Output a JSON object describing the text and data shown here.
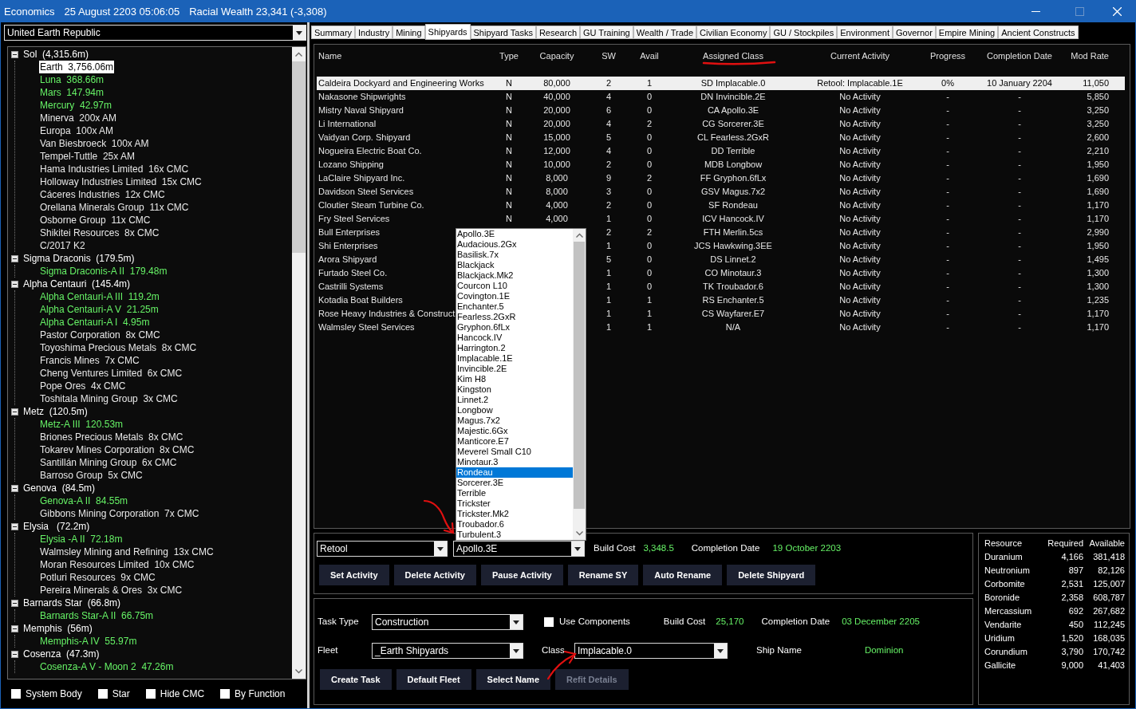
{
  "window": {
    "title": "Economics",
    "date": "25 August 2203 05:06:05",
    "wealth": "Racial Wealth 23,341 (-3,308)"
  },
  "race_select": {
    "value": "United Earth Republic"
  },
  "tree": [
    {
      "label": "Sol  (4,315.6m)",
      "expanded": true,
      "children": [
        {
          "label": "Earth  3,756.06m",
          "selected": true
        },
        {
          "label": "Luna  368.66m",
          "populated": true,
          "selected": false
        },
        {
          "label": "Mars  147.94m",
          "populated": true,
          "selected": false
        },
        {
          "label": "Mercury  42.97m",
          "populated": true,
          "selected": false
        },
        {
          "label": "Minerva  200x AM",
          "populated": false,
          "selected": false
        },
        {
          "label": "Europa  100x AM",
          "populated": false,
          "selected": false
        },
        {
          "label": "Van Biesbroeck  100x AM",
          "populated": false,
          "selected": false
        },
        {
          "label": "Tempel-Tuttle  25x AM",
          "populated": false,
          "selected": false
        },
        {
          "label": "Hama Industries Limited  16x CMC",
          "populated": false,
          "selected": false
        },
        {
          "label": "Holloway Industries Limited  15x CMC",
          "populated": false,
          "selected": false
        },
        {
          "label": "Cáceres Industries  12x CMC",
          "populated": false,
          "selected": false
        },
        {
          "label": "Orellana Minerals Group  11x CMC",
          "populated": false,
          "selected": false
        },
        {
          "label": "Osborne Group  11x CMC",
          "populated": false,
          "selected": false
        },
        {
          "label": "Shikitei Resources  8x CMC",
          "populated": false,
          "selected": false
        },
        {
          "label": "C/2017 K2",
          "populated": false,
          "selected": false
        }
      ]
    },
    {
      "label": "Sigma Draconis  (179.5m)",
      "expanded": true,
      "children": [
        {
          "label": "Sigma Draconis-A II  179.48m",
          "populated": true,
          "selected": false
        }
      ]
    },
    {
      "label": "Alpha Centauri  (145.4m)",
      "expanded": true,
      "children": [
        {
          "label": "Alpha Centauri-A III  119.2m",
          "populated": true,
          "selected": false
        },
        {
          "label": "Alpha Centauri-A V  21.25m",
          "populated": true,
          "selected": false
        },
        {
          "label": "Alpha Centauri-A I  4.95m",
          "populated": true,
          "selected": false
        },
        {
          "label": "Pastor Corporation  8x CMC",
          "populated": false,
          "selected": false
        },
        {
          "label": "Toyoshima Precious Metals  8x CMC",
          "populated": false,
          "selected": false
        },
        {
          "label": "Francis Mines  7x CMC",
          "populated": false,
          "selected": false
        },
        {
          "label": "Cheng Ventures Limited  6x CMC",
          "populated": false,
          "selected": false
        },
        {
          "label": "Pope Ores  4x CMC",
          "populated": false,
          "selected": false
        },
        {
          "label": "Toshitala Mining Group  3x CMC",
          "populated": false,
          "selected": false
        }
      ]
    },
    {
      "label": "Metz  (120.5m)",
      "expanded": true,
      "children": [
        {
          "label": "Metz-A III  120.53m",
          "populated": true,
          "selected": false
        },
        {
          "label": "Briones Precious Metals  8x CMC",
          "populated": false,
          "selected": false
        },
        {
          "label": "Tokarev Mines Corporation  8x CMC",
          "populated": false,
          "selected": false
        },
        {
          "label": "Santillán Mining Group  6x CMC",
          "populated": false,
          "selected": false
        },
        {
          "label": "Barroso Group  5x CMC",
          "populated": false,
          "selected": false
        }
      ]
    },
    {
      "label": "Genova  (84.5m)",
      "expanded": true,
      "children": [
        {
          "label": "Genova-A II  84.55m",
          "populated": true,
          "selected": false
        },
        {
          "label": "Gibbons Mining Corporation  7x CMC",
          "populated": false,
          "selected": false
        }
      ]
    },
    {
      "label": "Elysia   (72.2m)",
      "expanded": true,
      "children": [
        {
          "label": "Elysia -A II  72.18m",
          "populated": true,
          "selected": false
        },
        {
          "label": "Walmsley Mining and Refining  13x CMC",
          "populated": false,
          "selected": false
        },
        {
          "label": "Moran Resources Limited  10x CMC",
          "populated": false,
          "selected": false
        },
        {
          "label": "Potluri Resources  9x CMC",
          "populated": false,
          "selected": false
        },
        {
          "label": "Pereira Minerals & Ores  3x CMC",
          "populated": false,
          "selected": false
        }
      ]
    },
    {
      "label": "Barnards Star  (66.8m)",
      "expanded": true,
      "children": [
        {
          "label": "Barnards Star-A II  66.75m",
          "populated": true,
          "selected": false
        }
      ]
    },
    {
      "label": "Memphis  (56m)",
      "expanded": true,
      "children": [
        {
          "label": "Memphis-A IV  55.97m",
          "populated": true,
          "selected": false
        }
      ]
    },
    {
      "label": "Cosenza  (47.3m)",
      "expanded": true,
      "children": [
        {
          "label": "Cosenza-A V - Moon 2  47.26m",
          "populated": true,
          "selected": false
        }
      ]
    }
  ],
  "filters": [
    {
      "label": "System Body",
      "checked": false
    },
    {
      "label": "Star",
      "checked": false
    },
    {
      "label": "Hide CMC",
      "checked": false
    },
    {
      "label": "By Function",
      "checked": false
    }
  ],
  "tabs": [
    {
      "label": "Summary",
      "selected": false
    },
    {
      "label": "Industry",
      "selected": false
    },
    {
      "label": "Mining",
      "selected": false
    },
    {
      "label": "Shipyards",
      "selected": true
    },
    {
      "label": "Shipyard Tasks",
      "selected": false
    },
    {
      "label": "Research",
      "selected": false
    },
    {
      "label": "GU Training",
      "selected": false
    },
    {
      "label": "Wealth / Trade",
      "selected": false
    },
    {
      "label": "Civilian Economy",
      "selected": false
    },
    {
      "label": "GU / Stockpiles",
      "selected": false
    },
    {
      "label": "Environment",
      "selected": false
    },
    {
      "label": "Governor",
      "selected": false
    },
    {
      "label": "Empire Mining",
      "selected": false
    },
    {
      "label": "Ancient Constructs",
      "selected": false
    }
  ],
  "table": {
    "columns": [
      "Name",
      "Type",
      "Capacity",
      "SW",
      "Avail",
      "Assigned Class",
      "Current Activity",
      "Progress",
      "Completion Date",
      "Mod Rate"
    ],
    "rows": [
      {
        "name": "Caldeira Dockyard and Engineering Works",
        "type": "N",
        "capacity": "80,000",
        "sw": "2",
        "avail": "1",
        "assigned_class": "SD Implacable.0",
        "activity": "Retool: Implacable.1E",
        "progress": "0%",
        "completion": "10 January 2204",
        "mod_rate": "11,050",
        "selected": true
      },
      {
        "name": "Nakasone Shipwrights",
        "type": "N",
        "capacity": "40,000",
        "sw": "4",
        "avail": "0",
        "assigned_class": "DN Invincible.2E",
        "activity": "No Activity",
        "progress": "-",
        "completion": "-",
        "mod_rate": "5,850",
        "selected": false
      },
      {
        "name": "Mistry Naval Shipyard",
        "type": "N",
        "capacity": "20,000",
        "sw": "6",
        "avail": "0",
        "assigned_class": "CA Apollo.3E",
        "activity": "No Activity",
        "progress": "-",
        "completion": "-",
        "mod_rate": "3,250",
        "selected": false
      },
      {
        "name": "Li International",
        "type": "N",
        "capacity": "20,000",
        "sw": "4",
        "avail": "2",
        "assigned_class": "CG Sorcerer.3E",
        "activity": "No Activity",
        "progress": "-",
        "completion": "-",
        "mod_rate": "3,250",
        "selected": false
      },
      {
        "name": "Vaidyan Corp. Shipyard",
        "type": "N",
        "capacity": "15,000",
        "sw": "5",
        "avail": "0",
        "assigned_class": "CL Fearless.2GxR",
        "activity": "No Activity",
        "progress": "-",
        "completion": "-",
        "mod_rate": "2,600",
        "selected": false
      },
      {
        "name": "Nogueira Electric Boat Co.",
        "type": "N",
        "capacity": "12,000",
        "sw": "4",
        "avail": "0",
        "assigned_class": "DD Terrible",
        "activity": "No Activity",
        "progress": "-",
        "completion": "-",
        "mod_rate": "2,210",
        "selected": false
      },
      {
        "name": "Lozano Shipping",
        "type": "N",
        "capacity": "10,000",
        "sw": "2",
        "avail": "0",
        "assigned_class": "MDB Longbow",
        "activity": "No Activity",
        "progress": "-",
        "completion": "-",
        "mod_rate": "1,950",
        "selected": false
      },
      {
        "name": "LaClaire Shipyard Inc.",
        "type": "N",
        "capacity": "8,000",
        "sw": "9",
        "avail": "2",
        "assigned_class": "FF Gryphon.6fLx",
        "activity": "No Activity",
        "progress": "-",
        "completion": "-",
        "mod_rate": "1,690",
        "selected": false
      },
      {
        "name": "Davidson Steel Services",
        "type": "N",
        "capacity": "8,000",
        "sw": "3",
        "avail": "0",
        "assigned_class": "GSV Magus.7x2",
        "activity": "No Activity",
        "progress": "-",
        "completion": "-",
        "mod_rate": "1,690",
        "selected": false
      },
      {
        "name": "Cloutier Steam Turbine Co.",
        "type": "N",
        "capacity": "4,000",
        "sw": "2",
        "avail": "0",
        "assigned_class": "SF Rondeau",
        "activity": "No Activity",
        "progress": "-",
        "completion": "-",
        "mod_rate": "1,170",
        "selected": false
      },
      {
        "name": "Fry Steel Services",
        "type": "N",
        "capacity": "4,000",
        "sw": "1",
        "avail": "0",
        "assigned_class": "ICV Hancock.IV",
        "activity": "No Activity",
        "progress": "-",
        "completion": "-",
        "mod_rate": "1,170",
        "selected": false
      },
      {
        "name": "Bull Enterprises",
        "sw": "2",
        "avail": "2",
        "assigned_class": "FTH Merlin.5cs",
        "activity": "No Activity",
        "progress": "-",
        "completion": "-",
        "mod_rate": "2,990",
        "selected": false
      },
      {
        "name": "Shi Enterprises",
        "sw": "1",
        "avail": "0",
        "assigned_class": "JCS Hawkwing.3EE",
        "activity": "No Activity",
        "progress": "-",
        "completion": "-",
        "mod_rate": "1,950",
        "selected": false
      },
      {
        "name": "Arora Shipyard",
        "sw": "5",
        "avail": "0",
        "assigned_class": "DS Linnet.2",
        "activity": "No Activity",
        "progress": "-",
        "completion": "-",
        "mod_rate": "1,495",
        "selected": false
      },
      {
        "name": "Furtado Steel Co.",
        "sw": "1",
        "avail": "0",
        "assigned_class": "CO Minotaur.3",
        "activity": "No Activity",
        "progress": "-",
        "completion": "-",
        "mod_rate": "1,300",
        "selected": false
      },
      {
        "name": "Castrilli Systems",
        "sw": "1",
        "avail": "0",
        "assigned_class": "TK Troubador.6",
        "activity": "No Activity",
        "progress": "-",
        "completion": "-",
        "mod_rate": "1,300",
        "selected": false
      },
      {
        "name": "Kotadia Boat Builders",
        "sw": "1",
        "avail": "1",
        "assigned_class": "RS Enchanter.5",
        "activity": "No Activity",
        "progress": "-",
        "completion": "-",
        "mod_rate": "1,235",
        "selected": false
      },
      {
        "name": "Rose Heavy Industries & Construct",
        "sw": "1",
        "avail": "1",
        "assigned_class": "CS Wayfarer.E7",
        "activity": "No Activity",
        "progress": "-",
        "completion": "-",
        "mod_rate": "1,170",
        "selected": false
      },
      {
        "name": "Walmsley Steel Services",
        "sw": "1",
        "avail": "1",
        "assigned_class": "N/A",
        "activity": "No Activity",
        "progress": "-",
        "completion": "-",
        "mod_rate": "1,170",
        "selected": false
      }
    ]
  },
  "class_list": [
    {
      "label": "Apollo.3E",
      "selected": false
    },
    {
      "label": "Audacious.2Gx",
      "selected": false
    },
    {
      "label": "Basilisk.7x",
      "selected": false
    },
    {
      "label": "Blackjack",
      "selected": false
    },
    {
      "label": "Blackjack.Mk2",
      "selected": false
    },
    {
      "label": "Courcon L10",
      "selected": false
    },
    {
      "label": "Covington.1E",
      "selected": false
    },
    {
      "label": "Enchanter.5",
      "selected": false
    },
    {
      "label": "Fearless.2GxR",
      "selected": false
    },
    {
      "label": "Gryphon.6fLx",
      "selected": false
    },
    {
      "label": "Hancock.IV",
      "selected": false
    },
    {
      "label": "Harrington.2",
      "selected": false
    },
    {
      "label": "Implacable.1E",
      "selected": false
    },
    {
      "label": "Invincible.2E",
      "selected": false
    },
    {
      "label": "Kim H8",
      "selected": false
    },
    {
      "label": "Kingston",
      "selected": false
    },
    {
      "label": "Linnet.2",
      "selected": false
    },
    {
      "label": "Longbow",
      "selected": false
    },
    {
      "label": "Magus.7x2",
      "selected": false
    },
    {
      "label": "Majestic.6Gx",
      "selected": false
    },
    {
      "label": "Manticore.E7",
      "selected": false
    },
    {
      "label": "Meverel Small C10",
      "selected": false
    },
    {
      "label": "Minotaur.3",
      "selected": false
    },
    {
      "label": "Rondeau",
      "selected": true
    },
    {
      "label": "Sorcerer.3E",
      "selected": false
    },
    {
      "label": "Terrible",
      "selected": false
    },
    {
      "label": "Trickster",
      "selected": false
    },
    {
      "label": "Trickster.Mk2",
      "selected": false
    },
    {
      "label": "Troubador.6",
      "selected": false
    },
    {
      "label": "Turbulent.3",
      "selected": false
    }
  ],
  "activity": {
    "activity_value": "Retool",
    "class_value": "Apollo.3E",
    "build_cost_label": "Build Cost",
    "build_cost": "3,348.5",
    "completion_label": "Completion Date",
    "completion": "19 October 2203",
    "buttons": [
      {
        "label": "Set Activity",
        "disabled": false
      },
      {
        "label": "Delete Activity",
        "disabled": false
      },
      {
        "label": "Pause Activity",
        "disabled": false
      },
      {
        "label": "Rename SY",
        "disabled": false
      },
      {
        "label": "Auto Rename",
        "disabled": false
      },
      {
        "label": "Delete Shipyard",
        "disabled": false
      }
    ]
  },
  "task": {
    "task_type_label": "Task Type",
    "task_type": "Construction",
    "use_components": {
      "label": "Use Components",
      "checked": false
    },
    "build_cost_label": "Build Cost",
    "build_cost": "25,170",
    "completion_label": "Completion Date",
    "completion": "03 December 2205",
    "fleet_label": "Fleet",
    "fleet": "_Earth Shipyards",
    "class_label": "Class",
    "class": "Implacable.0",
    "ship_name_label": "Ship Name",
    "ship_name": "Dominion",
    "buttons": [
      {
        "label": "Create Task",
        "disabled": false
      },
      {
        "label": "Default Fleet",
        "disabled": false
      },
      {
        "label": "Select Name",
        "disabled": false
      },
      {
        "label": "Refit Details",
        "disabled": true
      }
    ]
  },
  "resources": {
    "columns": [
      "Resource",
      "Required",
      "Available"
    ],
    "rows": [
      [
        "Duranium",
        "4,166",
        "381,418"
      ],
      [
        "Neutronium",
        "897",
        "82,126"
      ],
      [
        "Corbomite",
        "2,531",
        "125,007"
      ],
      [
        "Boronide",
        "2,358",
        "608,787"
      ],
      [
        "Mercassium",
        "692",
        "267,682"
      ],
      [
        "Vendarite",
        "450",
        "112,245"
      ],
      [
        "Uridium",
        "1,520",
        "168,035"
      ],
      [
        "Corundium",
        "3,790",
        "170,742"
      ],
      [
        "Gallicite",
        "9,000",
        "41,403"
      ]
    ]
  }
}
